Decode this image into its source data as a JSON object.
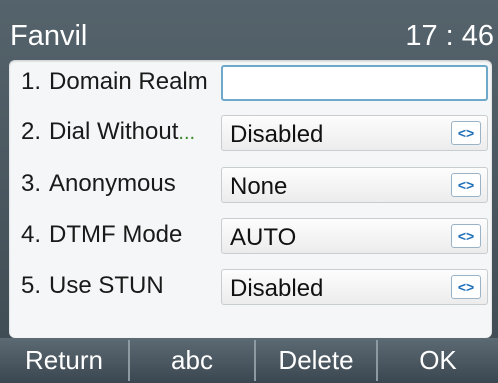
{
  "header": {
    "title": "Fanvil",
    "time": "17 : 46"
  },
  "rows": [
    {
      "number": "1.",
      "label": "Domain Realm",
      "value": "",
      "has_arrows": false,
      "active": true
    },
    {
      "number": "2.",
      "label": "Dial Without",
      "ellipsis": "...",
      "value": "Disabled",
      "has_arrows": true
    },
    {
      "number": "3.",
      "label": "Anonymous",
      "value": "None",
      "has_arrows": true
    },
    {
      "number": "4.",
      "label": "DTMF Mode",
      "value": "AUTO",
      "has_arrows": true
    },
    {
      "number": "5.",
      "label": "Use STUN",
      "value": "Disabled",
      "has_arrows": true
    }
  ],
  "arrows_glyph": "<>",
  "softkeys": [
    "Return",
    "abc",
    "Delete",
    "OK"
  ]
}
